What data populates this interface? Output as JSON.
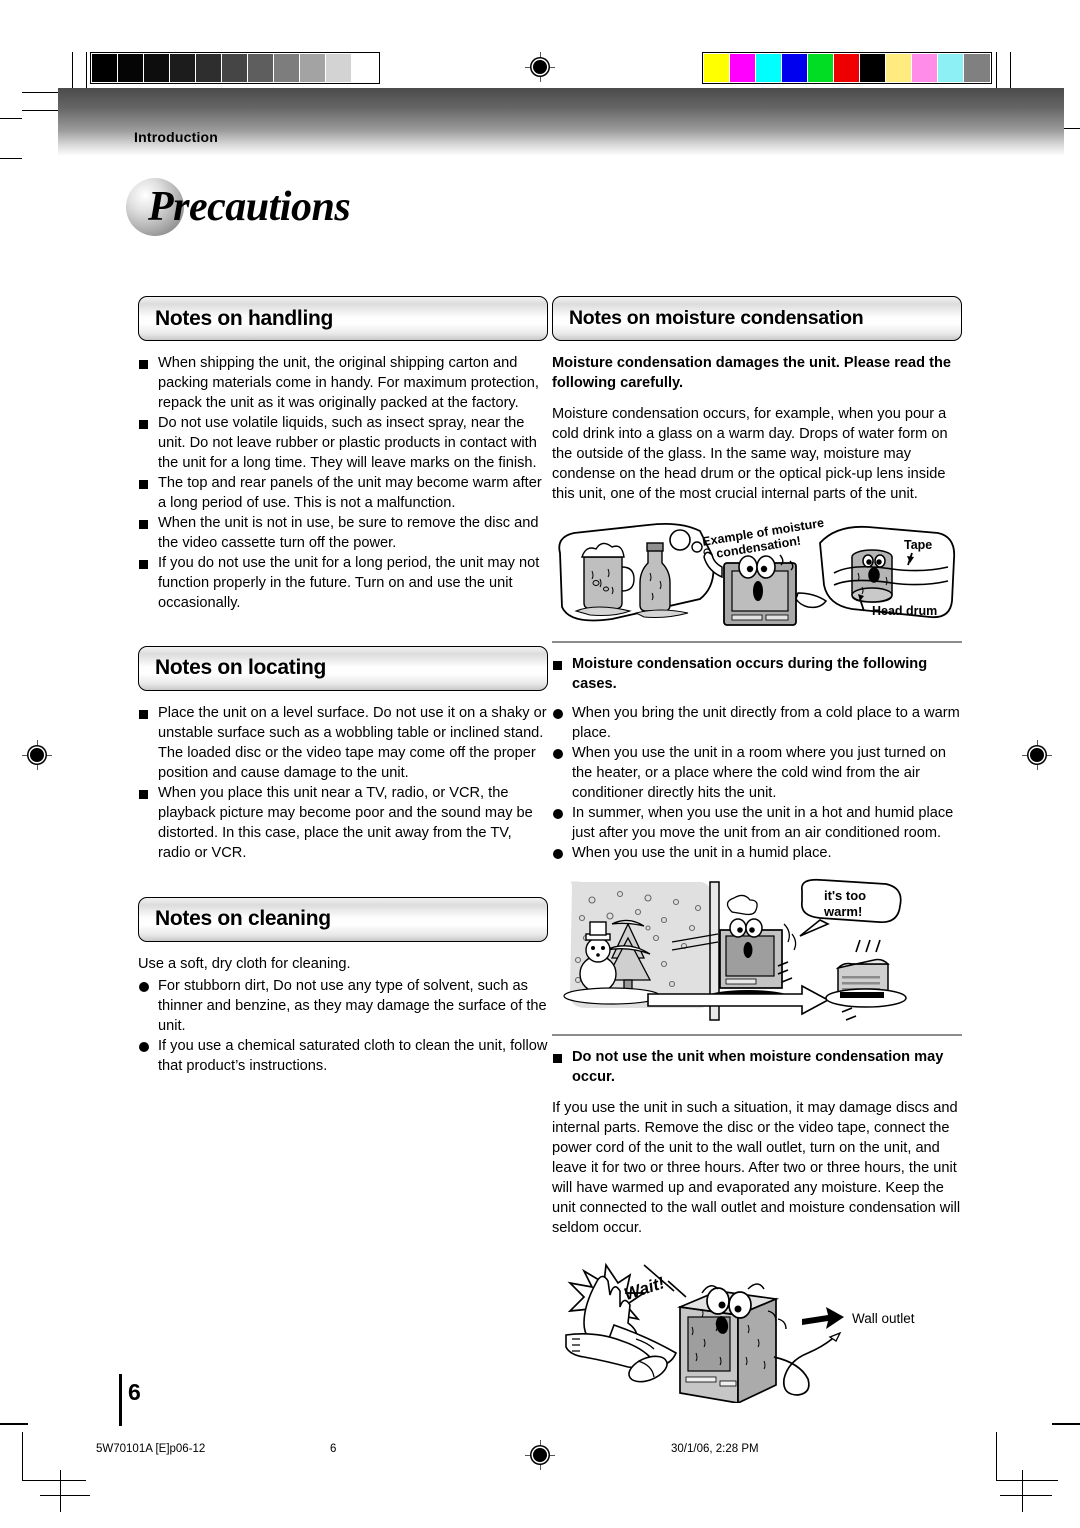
{
  "header": {
    "section_label": "Introduction",
    "page_title": "Precautions"
  },
  "calibration": {
    "grayscale_label": "grayscale-calibration-bar",
    "grayscale_swatches": [
      "#000000",
      "#050505",
      "#0d0d0d",
      "#1c1c1c",
      "#2e2e2e",
      "#454545",
      "#5e5e5e",
      "#7d7d7d",
      "#a3a3a3",
      "#d3d3d3",
      "#ffffff"
    ],
    "color_label": "color-calibration-bar",
    "color_swatches": [
      "#ffff00",
      "#ff00ff",
      "#00ffff",
      "#0000ee",
      "#00dd22",
      "#ee0000",
      "#000000",
      "#ffeb80",
      "#ff8ce8",
      "#8cf0f5",
      "#808080"
    ]
  },
  "left_column": {
    "handling": {
      "heading": "Notes on handling",
      "items": [
        "When shipping the unit, the original shipping carton and packing materials come in handy. For maximum protection, repack the unit as it was originally packed at the factory.",
        "Do not use volatile liquids, such as insect spray, near the unit. Do not leave rubber or plastic products in contact with the unit for a long time. They will leave marks on the finish.",
        "The top and rear panels of the unit may become warm after a long period of use. This is not a malfunction.",
        "When the unit is not in use, be sure to remove the disc and the video cassette turn off the power.",
        "If you do not use the unit for a long period, the unit may not function properly in the future. Turn on and use the unit occasionally."
      ]
    },
    "locating": {
      "heading": "Notes on locating",
      "items": [
        "Place the unit on a level surface. Do not use it on a shaky or unstable surface such as a wobbling table or inclined stand. The loaded disc or the video tape may come off the proper position and cause damage to the unit.",
        "When you place this unit near a TV, radio, or VCR, the playback picture may become poor and the sound may be distorted. In this case, place the unit away from the TV, radio or VCR."
      ]
    },
    "cleaning": {
      "heading": "Notes on cleaning",
      "intro": "Use a soft, dry cloth for cleaning.",
      "items": [
        "For stubborn dirt, Do not use any type of solvent, such as thinner and benzine, as they may damage the surface of the unit.",
        "If you use a chemical saturated cloth to clean the unit, follow that product’s instructions."
      ]
    }
  },
  "right_column": {
    "condensation": {
      "heading": "Notes on moisture condensation",
      "lead": "Moisture condensation damages the unit. Please read the following carefully.",
      "body": "Moisture condensation occurs, for example, when you pour a cold drink into a glass on a warm day. Drops of water form on the outside of the glass. In the same way, moisture may condense on the head drum or the optical pick-up lens inside this unit, one of the most crucial internal parts of the unit."
    },
    "figure_example": {
      "caption_line1": "Example of moisture",
      "caption_line2": "condensation!",
      "label_tape": "Tape",
      "label_head_drum": "Head drum"
    },
    "occurs": {
      "heading": "Moisture condensation occurs during the following cases.",
      "items": [
        "When you bring the unit directly from a cold place to a warm place.",
        "When you use the unit in a room where you just turned on the heater, or a place where the cold wind from the air conditioner directly hits the unit.",
        "In summer, when you use the unit in a hot and humid place just after you move the unit from an air conditioned room.",
        "When you use the unit in a humid place."
      ]
    },
    "figure_cold_warm": {
      "speech_line1": "it's too",
      "speech_line2": "warm!"
    },
    "do_not_use": {
      "heading": "Do not use the unit when moisture condensation may occur.",
      "body": "If you use the unit in such a situation, it may damage discs and internal parts. Remove the disc or the video tape, connect the power cord of the unit to the wall outlet, turn on the unit, and leave it for two or three hours. After two or three hours, the unit will have warmed up and evaporated any moisture. Keep the unit connected to the wall outlet and moisture condensation will seldom occur."
    },
    "figure_wait": {
      "speech": "Wait!",
      "label_wall_outlet": "Wall outlet"
    }
  },
  "footer": {
    "page_number": "6",
    "doc_code": "5W70101A [E]p06-12",
    "footer_page": "6",
    "timestamp": "30/1/06, 2:28 PM"
  }
}
